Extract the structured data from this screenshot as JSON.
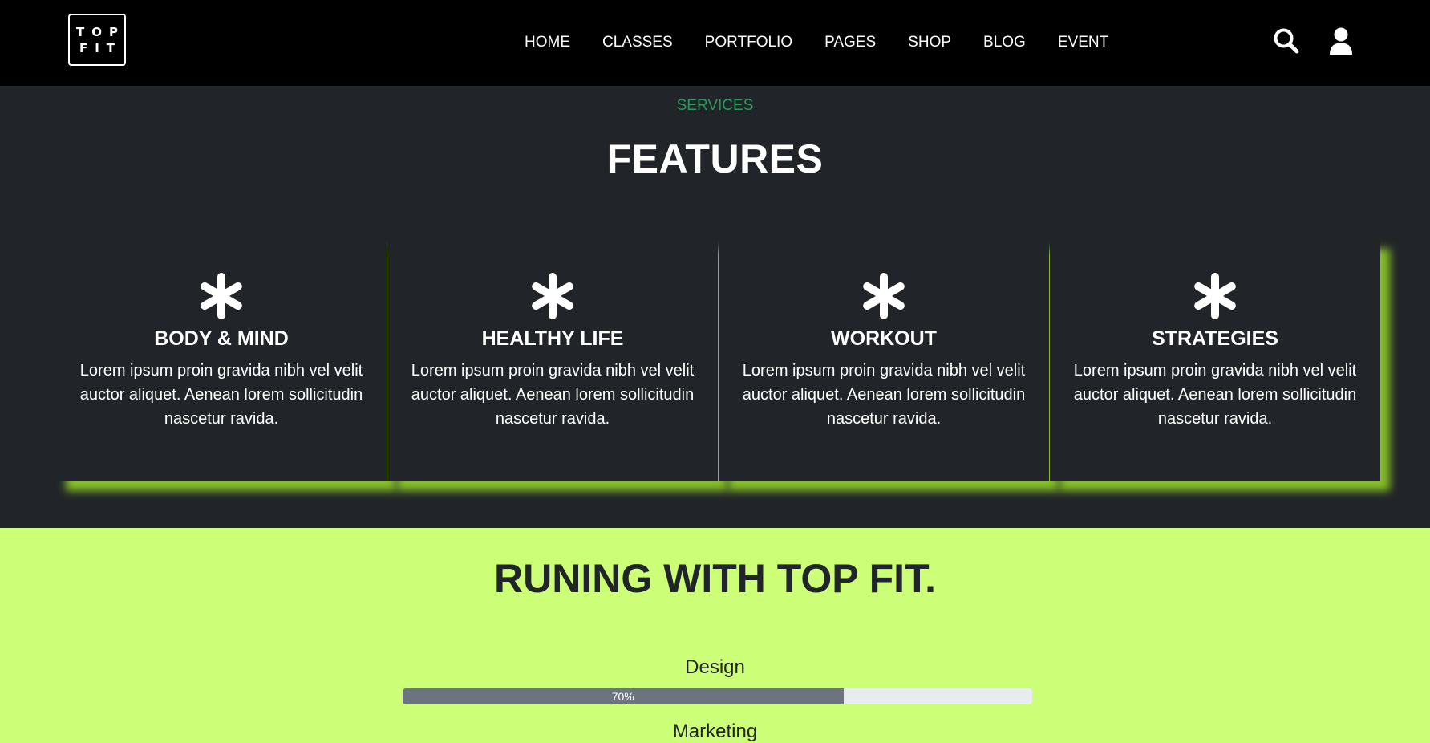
{
  "brand": {
    "logo_line1": "TOP",
    "logo_line2": "FIT"
  },
  "nav": {
    "links": [
      "HOME",
      "CLASSES",
      "PORTFOLIO",
      "PAGES",
      "SHOP",
      "BLOG",
      "EVENT"
    ],
    "icons": [
      "search-icon",
      "user-icon"
    ]
  },
  "services": {
    "eyebrow": "SERVICES",
    "title": "FEATURES",
    "cards": [
      {
        "icon": "asterisk-icon",
        "title": "BODY & MIND",
        "text": "Lorem ipsum proin gravida nibh vel velit auctor aliquet. Aenean lorem sollicitudin nascetur ravida."
      },
      {
        "icon": "asterisk-icon",
        "title": "HEALTHY LIFE",
        "text": "Lorem ipsum proin gravida nibh vel velit auctor aliquet. Aenean lorem sollicitudin nascetur ravida."
      },
      {
        "icon": "asterisk-icon",
        "title": "WORKOUT",
        "text": "Lorem ipsum proin gravida nibh vel velit auctor aliquet. Aenean lorem sollicitudin nascetur ravida."
      },
      {
        "icon": "asterisk-icon",
        "title": "STRATEGIES",
        "text": "Lorem ipsum proin gravida nibh vel velit auctor aliquet. Aenean lorem sollicitudin nascetur ravida."
      }
    ]
  },
  "running": {
    "title": "RUNING WITH TOP FIT.",
    "skills": [
      {
        "label": "Design",
        "percent": 70,
        "percent_label": "70%"
      },
      {
        "label": "Marketing"
      }
    ]
  },
  "colors": {
    "navbar_bg": "#000000",
    "section_bg": "#212529",
    "accent_green": "#ccff77",
    "card_glow": "#8bc828",
    "eyebrow": "#2e9a5a",
    "progress_fill": "#6c757d",
    "progress_track": "#e9ecef"
  }
}
